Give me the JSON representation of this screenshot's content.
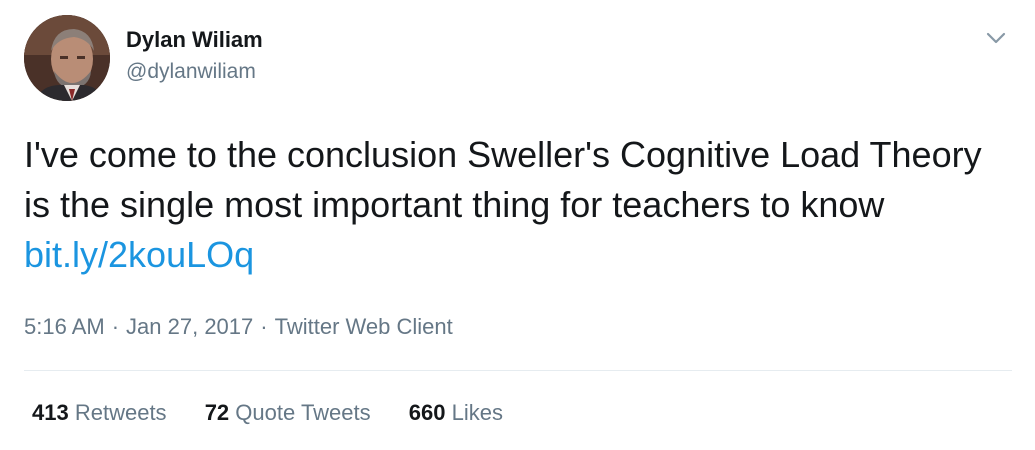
{
  "author": {
    "display_name": "Dylan Wiliam",
    "handle": "@dylanwiliam"
  },
  "icons": {
    "avatar": "user-avatar-photo",
    "menu": "chevron-down-icon"
  },
  "tweet": {
    "text": "I've come to the conclusion Sweller's Cognitive Load Theory is the single most important thing for teachers to know",
    "link": "bit.ly/2kouLOq"
  },
  "meta": {
    "time": "5:16 AM",
    "date": "Jan 27, 2017",
    "separator": "·",
    "source": "Twitter Web Client"
  },
  "stats": {
    "retweets": {
      "count": "413",
      "label": "Retweets"
    },
    "quote_tweets": {
      "count": "72",
      "label": "Quote Tweets"
    },
    "likes": {
      "count": "660",
      "label": "Likes"
    }
  },
  "colors": {
    "text": "#14171a",
    "secondary": "#657786",
    "link": "#1b95e0",
    "divider": "#e6ecf0"
  }
}
